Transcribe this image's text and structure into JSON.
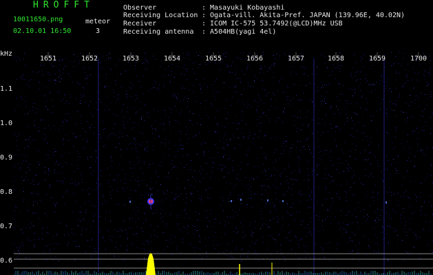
{
  "header": {
    "logo": "HROFFT",
    "filename": "10011650.png",
    "datetime": "02.10.01 16:50",
    "meteor_label": "meteor",
    "meteor_count": "3",
    "fields": [
      {
        "label": "Observer",
        "value": ": Masayuki Kobayashi"
      },
      {
        "label": "Receiving Location",
        "value": ": Ogata-vill. Akita-Pref. JAPAN (139.96E, 40.02N)"
      },
      {
        "label": "Receiver",
        "value": ": ICOM IC-575 53.7492(@LCD)MHz USB"
      },
      {
        "label": "Receiving antenna",
        "value": ": A504HB(yagi 4el)"
      }
    ]
  },
  "chart_data": {
    "type": "heatmap",
    "x_ticks": [
      "1651",
      "1652",
      "1653",
      "1654",
      "1655",
      "1656",
      "1657",
      "1658",
      "1659",
      "1700"
    ],
    "y_unit": "kHz",
    "y_ticks": [
      "1.1",
      "1.0",
      "0.9",
      "0.8",
      "0.7",
      "0.6"
    ],
    "colors": {
      "background": "#000",
      "noise": "#1a1a8c",
      "header_green": "#2ee82e",
      "spectrum": "#ffff00"
    }
  }
}
